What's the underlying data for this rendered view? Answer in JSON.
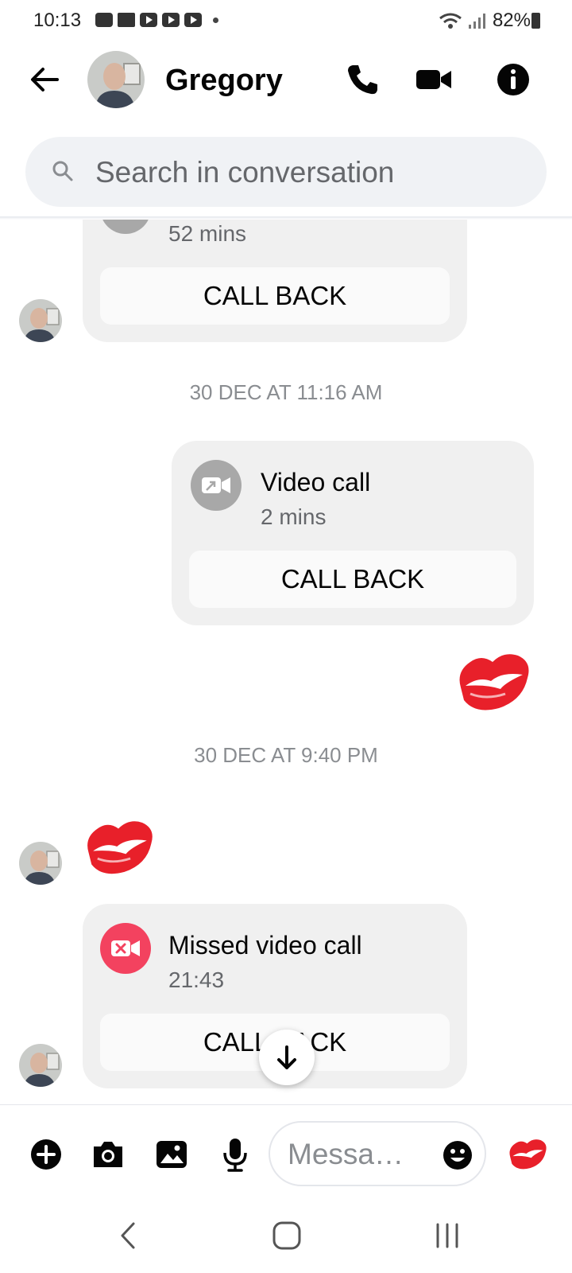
{
  "status_bar": {
    "time": "10:13",
    "battery": "82%",
    "left_icons": [
      "shop-icon",
      "folder-icon",
      "youtube-icon",
      "youtube-icon",
      "youtube-icon"
    ],
    "right_icons": [
      "wifi-icon",
      "signal-icon",
      "battery-icon"
    ]
  },
  "header": {
    "contact_name": "Gregory",
    "icons": [
      "back-arrow-icon",
      "phone-icon",
      "video-camera-icon",
      "info-icon"
    ]
  },
  "search": {
    "placeholder": "Search in conversation"
  },
  "messages": {
    "call_1": {
      "duration": "52 mins",
      "button": "CALL BACK"
    },
    "timestamp_1": "30 DEC AT 11:16 AM",
    "call_2": {
      "title": "Video call",
      "duration": "2 mins",
      "button": "CALL BACK"
    },
    "timestamp_2": "30 DEC AT 9:40 PM",
    "call_3": {
      "title": "Missed video call",
      "time": "21:43",
      "button": "CALL BACK"
    },
    "reactions": [
      "kiss-mark-icon",
      "kiss-mark-icon"
    ]
  },
  "composer": {
    "placeholder": "Messa…",
    "icons": [
      "plus-icon",
      "camera-icon",
      "gallery-icon",
      "microphone-icon",
      "emoji-icon",
      "kiss-mark-icon"
    ]
  },
  "nav_bar": {
    "icons": [
      "back-nav-icon",
      "home-nav-icon",
      "recents-nav-icon"
    ]
  },
  "colors": {
    "missed_call": "#f3425f",
    "kiss": "#e8202a",
    "card_bg": "#f0f0f0",
    "muted_text": "#65676b"
  }
}
